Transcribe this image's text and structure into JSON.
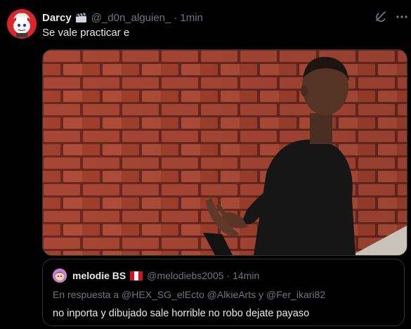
{
  "tweet": {
    "display_name": "Darcy",
    "name_emoji_icon": "clapper-board-icon",
    "handle": "@_d0n_alguien_",
    "separator": "·",
    "time": "1min",
    "text": "Se vale practicar e",
    "media_alt_icon": "man-talking-to-brick-wall-photo"
  },
  "quote": {
    "display_name": "melodie BS",
    "flag_icon": "peru-flag-icon",
    "handle": "@melodiebs2005",
    "separator": "·",
    "time": "14min",
    "reply_prefix": "En respuesta a",
    "reply_to": [
      "@HEX_SG_elEcto",
      "@AlkieArts",
      "@Fer_ikari82"
    ],
    "reply_text": "En respuesta a @HEX_SG_elEcto @AlkieArts y @Fer_ikari82",
    "text": "no inporta y dibujado sale horrible no robo dejate payaso"
  },
  "colors": {
    "background": "#000000",
    "primary_text": "#e7e9ea",
    "secondary_text": "#71767b",
    "border": "#2f3336"
  }
}
